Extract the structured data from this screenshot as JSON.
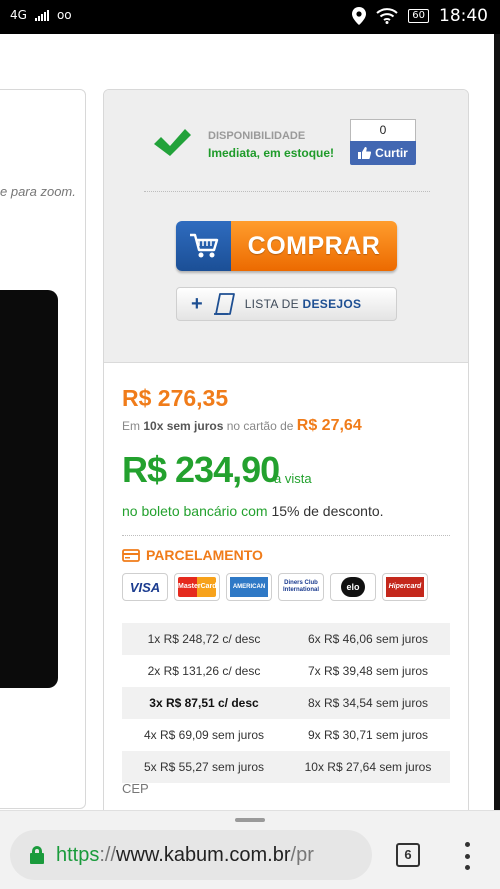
{
  "status_bar": {
    "network": "4G",
    "voicemail": "oo",
    "battery": "60",
    "time": "18:40"
  },
  "gallery": {
    "zoom_hint": "e para zoom."
  },
  "availability": {
    "label": "DISPONIBILIDADE",
    "value": "Imediata, em estoque!"
  },
  "like_widget": {
    "count": "0",
    "label": "Curtir"
  },
  "buy_button": {
    "label": "COMPRAR"
  },
  "wishlist_button": {
    "label_light": "LISTA DE ",
    "label_bold": "DESEJOS"
  },
  "pricing": {
    "price": "R$ 276,35",
    "installment_prefix": "Em ",
    "installment_bold": "10x sem juros",
    "installment_suffix": " no cartão de ",
    "installment_value": "R$ 27,64",
    "cash_price": "R$ 234,90",
    "cash_label": "à vista",
    "boleto_prefix": "no boleto bancário com ",
    "boleto_discount": "15% de desconto."
  },
  "parcelamento": {
    "title": "PARCELAMENTO",
    "cards": [
      {
        "name": "VISA"
      },
      {
        "name": "MasterCard"
      },
      {
        "name": "AMERICAN EXPRESS"
      },
      {
        "name": "Diners Club International"
      },
      {
        "name": "elo"
      },
      {
        "name": "Hipercard"
      }
    ],
    "rows": [
      {
        "left": "1x R$ 248,72 c/ desc",
        "right": "6x R$ 46,06 sem juros"
      },
      {
        "left": "2x R$ 131,26 c/ desc",
        "right": "7x R$ 39,48 sem juros"
      },
      {
        "left": "3x R$ 87,51 c/ desc",
        "right": "8x R$ 34,54 sem juros"
      },
      {
        "left": "4x R$ 69,09 sem juros",
        "right": "9x R$ 30,71 sem juros"
      },
      {
        "left": "5x R$ 55,27 sem juros",
        "right": "10x R$ 27,64 sem juros"
      }
    ]
  },
  "cep": {
    "label": "CEP"
  },
  "browser": {
    "url_scheme": "https",
    "url_sep": "://",
    "url_host": "www.kabum.com.br",
    "url_rest": "/pr",
    "tab_count": "6"
  },
  "colors": {
    "orange": "#f07c1a",
    "green": "#23a12e",
    "blue": "#1e4f92"
  }
}
